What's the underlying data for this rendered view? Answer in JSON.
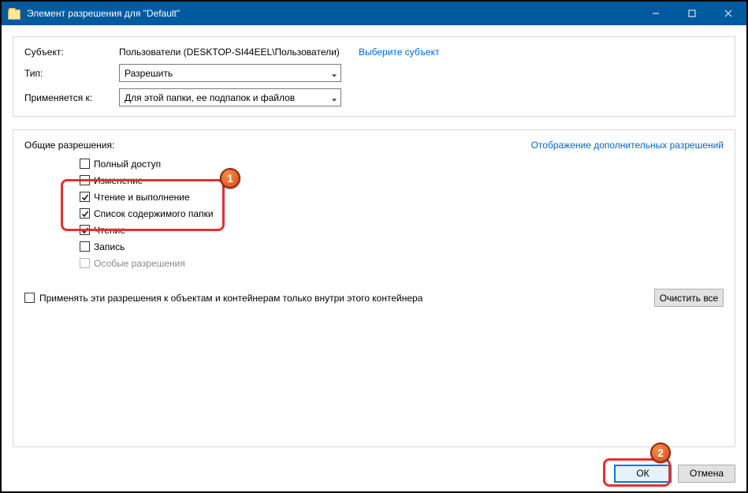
{
  "window": {
    "title": "Элемент разрешения для \"Default\""
  },
  "upper": {
    "subject_label": "Субъект:",
    "subject_value": "Пользователи (DESKTOP-SI44EEL\\Пользователи)",
    "select_subject_link": "Выберите субъект",
    "type_label": "Тип:",
    "type_value": "Разрешить",
    "applies_label": "Применяется к:",
    "applies_value": "Для этой папки, ее подпапок и файлов"
  },
  "permissions": {
    "title": "Общие разрешения:",
    "adv_link": "Отображение дополнительных разрешений",
    "items": [
      {
        "label": "Полный доступ",
        "checked": false,
        "disabled": false
      },
      {
        "label": "Изменение",
        "checked": false,
        "disabled": false
      },
      {
        "label": "Чтение и выполнение",
        "checked": true,
        "disabled": false
      },
      {
        "label": "Список содержимого папки",
        "checked": true,
        "disabled": false
      },
      {
        "label": "Чтение",
        "checked": true,
        "disabled": false
      },
      {
        "label": "Запись",
        "checked": false,
        "disabled": false
      },
      {
        "label": "Особые разрешения",
        "checked": false,
        "disabled": true
      }
    ],
    "apply_inside_label": "Применять эти разрешения к объектам и контейнерам только внутри этого контейнера",
    "clear_label": "Очистить все"
  },
  "buttons": {
    "ok": "ОК",
    "cancel": "Отмена"
  },
  "annotations": {
    "badge1": "1",
    "badge2": "2"
  }
}
